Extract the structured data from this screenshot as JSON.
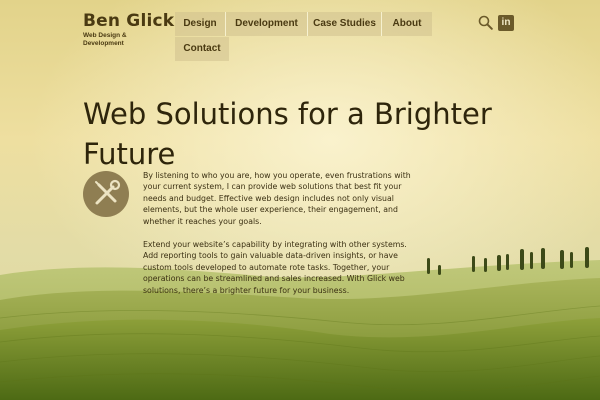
{
  "brand": {
    "name": "Ben Glick",
    "tagline": "Web Design & Development"
  },
  "nav": {
    "items": [
      {
        "label": "Design"
      },
      {
        "label": "Development"
      },
      {
        "label": "Case Studies"
      },
      {
        "label": "About"
      },
      {
        "label": "Contact"
      }
    ]
  },
  "header_tools": {
    "search_icon": "search-icon",
    "social_icon": "linkedin-icon",
    "social_label": "in"
  },
  "hero": {
    "title": "Web Solutions for a Brighter Future",
    "icon": "tools-icon",
    "paragraphs": [
      "By listening to who you are, how you operate, even frustrations with your current system, I can provide web solutions that best fit your needs and budget. Effective web design includes not only visual elements, but the whole user experience, their engagement, and whether it reaches your goals.",
      "Extend your website’s capability by integrating with other systems. Add reporting tools to gain valuable data-driven insights, or have custom tools developed to automate rote tasks. Together, your operations can be streamlined and sales increased. With Glick web solutions, there’s a brighter future for your business."
    ]
  },
  "colors": {
    "text_dark": "#2e250b",
    "brand": "#4a3a12",
    "nav_bg": "#cdbe8c",
    "icon_circle": "#8f7e52"
  }
}
